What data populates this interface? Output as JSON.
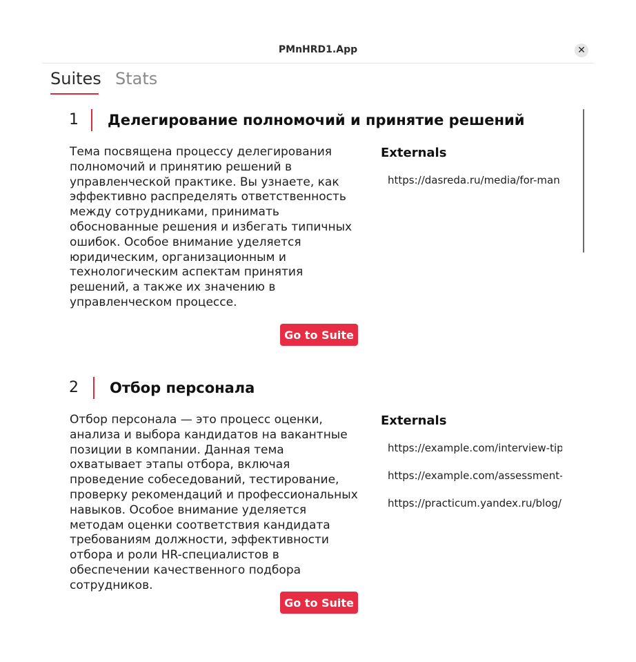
{
  "window": {
    "title": "PMnHRD1.App",
    "close_symbol": "✕"
  },
  "tabs": [
    {
      "label": "Suites",
      "active": true
    },
    {
      "label": "Stats",
      "active": false
    }
  ],
  "suites": [
    {
      "number": "1",
      "title": "Делегирование полномочий и принятие решений",
      "description": "Тема посвящена процессу делегирования полномочий и принятию решений в управленческой практике. Вы узнаете, как эффективно распределять ответственность между сотрудниками, принимать обоснованные решения и избегать типичных ошибок. Особое внимание уделяется юридическим, организационным и технологическим аспектам принятия решений, а также их значению в управленческом процессе.",
      "externals_title": "Externals",
      "externals": [
        "https://dasreda.ru/media/for-man"
      ],
      "button_label": "Go to Suite"
    },
    {
      "number": "2",
      "title": "Отбор персонала",
      "description": "Отбор персонала — это процесс оценки, анализа и выбора кандидатов на вакантные позиции в компании. Данная тема охватывает этапы отбора, включая проведение собеседований, тестирование, проверку рекомендаций и профессиональных навыков. Особое внимание уделяется методам оценки соответствия кандидата требованиям должности, эффективности отбора и роли HR-специалистов в обеспечении качественного подбора сотрудников.",
      "externals_title": "Externals",
      "externals": [
        "https://example.com/interview-tip",
        "https://example.com/assessment-",
        "https://practicum.yandex.ru/blog/"
      ],
      "button_label": "Go to Suite"
    }
  ],
  "colors": {
    "accent": "#e0283f",
    "button_bg": "#e62d44"
  }
}
